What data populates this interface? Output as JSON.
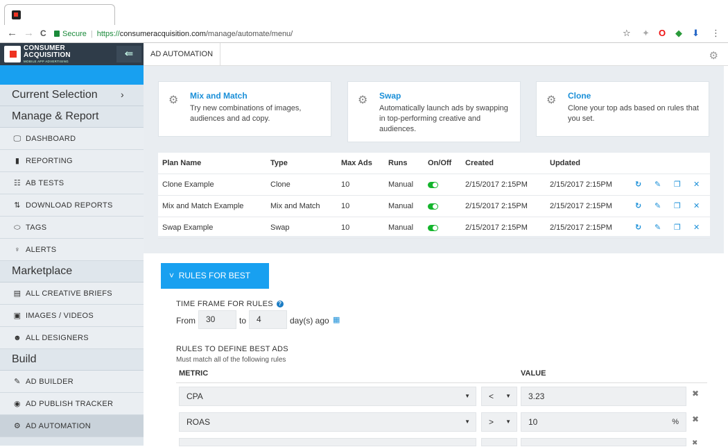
{
  "browser": {
    "nav_back": "←",
    "nav_forward": "→",
    "nav_reload": "C",
    "secure_label": "Secure",
    "url_scheme": "https://",
    "url_host": "consumeracquisition.com",
    "url_path": "/manage/automate/menu/",
    "star": "☆"
  },
  "brand": {
    "name_line1": "CONSUMER",
    "name_line2": "ACQUISITION",
    "tagline": "MOBILE APP ADVERTISING"
  },
  "sidebar": {
    "current_selection": "Current Selection",
    "manage_report": "Manage & Report",
    "manage_items": [
      {
        "icon": "monitor-icon",
        "glyph": "🖵",
        "label": "DASHBOARD"
      },
      {
        "icon": "bar-chart-icon",
        "glyph": "▮",
        "label": "REPORTING"
      },
      {
        "icon": "ab-tests-icon",
        "glyph": "☷",
        "label": "AB TESTS"
      },
      {
        "icon": "download-icon",
        "glyph": "⇅",
        "label": "DOWNLOAD REPORTS"
      },
      {
        "icon": "tag-icon",
        "glyph": "⬭",
        "label": "TAGS"
      },
      {
        "icon": "bulb-icon",
        "glyph": "♀",
        "label": "ALERTS"
      }
    ],
    "marketplace": "Marketplace",
    "market_items": [
      {
        "icon": "document-icon",
        "glyph": "▤",
        "label": "ALL CREATIVE BRIEFS"
      },
      {
        "icon": "images-icon",
        "glyph": "▣",
        "label": "IMAGES / VIDEOS"
      },
      {
        "icon": "users-icon",
        "glyph": "☻",
        "label": "ALL DESIGNERS"
      }
    ],
    "build": "Build",
    "build_items": [
      {
        "icon": "wand-icon",
        "glyph": "✎",
        "label": "AD BUILDER"
      },
      {
        "icon": "target-icon",
        "glyph": "◉",
        "label": "AD PUBLISH TRACKER"
      },
      {
        "icon": "gears-icon",
        "glyph": "⚙",
        "label": "AD AUTOMATION"
      }
    ]
  },
  "topbar": {
    "title": "AD AUTOMATION"
  },
  "cards": [
    {
      "title": "Mix and Match",
      "desc": "Try new combinations of images, audiences and ad copy."
    },
    {
      "title": "Swap",
      "desc": "Automatically launch ads by swapping in top-performing creative and audiences."
    },
    {
      "title": "Clone",
      "desc": "Clone your top ads based on rules that you set."
    }
  ],
  "plans": {
    "headers": [
      "Plan Name",
      "Type",
      "Max Ads",
      "Runs",
      "On/Off",
      "Created",
      "Updated"
    ],
    "rows": [
      {
        "name": "Clone Example",
        "type": "Clone",
        "max_ads": "10",
        "runs": "Manual",
        "on": true,
        "created": "2/15/2017 2:15PM",
        "updated": "2/15/2017 2:15PM"
      },
      {
        "name": "Mix and Match Example",
        "type": "Mix and Match",
        "max_ads": "10",
        "runs": "Manual",
        "on": true,
        "created": "2/15/2017 2:15PM",
        "updated": "2/15/2017 2:15PM"
      },
      {
        "name": "Swap Example",
        "type": "Swap",
        "max_ads": "10",
        "runs": "Manual",
        "on": true,
        "created": "2/15/2017 2:15PM",
        "updated": "2/15/2017 2:15PM"
      }
    ],
    "actions": [
      {
        "icon": "refresh-icon",
        "glyph": "↻"
      },
      {
        "icon": "edit-icon",
        "glyph": "✎"
      },
      {
        "icon": "copy-icon",
        "glyph": "❐"
      },
      {
        "icon": "delete-icon",
        "glyph": "✕"
      }
    ]
  },
  "rules": {
    "button": "RULES FOR BEST ADS",
    "timeframe_label": "TIME FRAME FOR RULES",
    "from_label": "From",
    "from_value": "30",
    "to_label": "to",
    "to_value": "4",
    "ago_label": "day(s) ago",
    "define_label": "RULES TO DEFINE BEST ADS",
    "define_sub": "Must match all of the following rules",
    "metric_header": "METRIC",
    "value_header": "VALUE",
    "rows": [
      {
        "metric": "CPA",
        "op": "<",
        "value": "3.23",
        "unit": ""
      },
      {
        "metric": "ROAS",
        "op": ">",
        "value": "10",
        "unit": "%"
      }
    ]
  },
  "colors": {
    "accent": "#18a0f0",
    "sidebar_dark": "#2f3c49",
    "toggle_on": "#14b52c"
  }
}
